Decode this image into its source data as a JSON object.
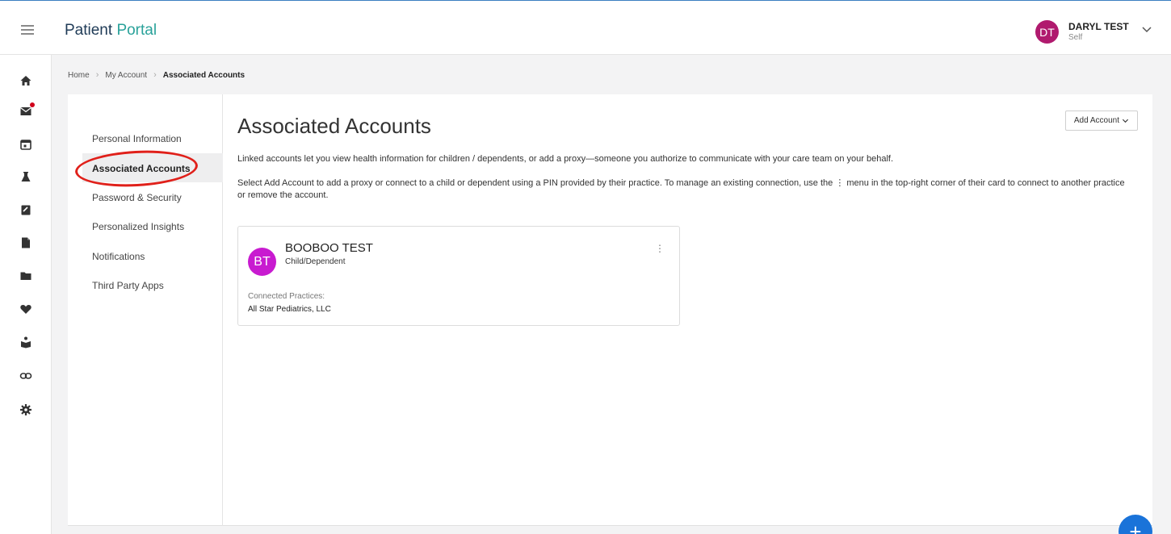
{
  "header": {
    "brand_main": "Patient",
    "brand_accent": "Portal",
    "user": {
      "initials": "DT",
      "name": "DARYL TEST",
      "role": "Self"
    }
  },
  "rail": {
    "icons": [
      "home-icon",
      "mail-icon",
      "calendar-icon",
      "lab-flask-icon",
      "clipboard-icon",
      "document-icon",
      "folder-icon",
      "heart-icon",
      "education-icon",
      "link-icon",
      "gear-icon"
    ]
  },
  "breadcrumb": {
    "home": "Home",
    "account": "My Account",
    "current": "Associated Accounts"
  },
  "side_menu": {
    "items": [
      {
        "label": "Personal Information"
      },
      {
        "label": "Associated Accounts"
      },
      {
        "label": "Password & Security"
      },
      {
        "label": "Personalized Insights"
      },
      {
        "label": "Notifications"
      },
      {
        "label": "Third Party Apps"
      }
    ]
  },
  "main": {
    "title": "Associated Accounts",
    "add_account_label": "Add Account",
    "description_1": "Linked accounts let you view health information for children / dependents, or add a proxy—someone you authorize to communicate with your care team on your behalf.",
    "description_2": "Select Add Account to add a proxy or connect to a child or dependent using a PIN provided by their practice. To manage an existing connection, use the ⋮ menu in the top-right corner of their card to connect to another practice or remove the account.",
    "account": {
      "initials": "BT",
      "name": "BOOBOO TEST",
      "type": "Child/Dependent",
      "connected_label": "Connected Practices:",
      "practice": "All Star Pediatrics, LLC"
    }
  },
  "fab_label": "+",
  "colors": {
    "brand_accent": "#2aa29a",
    "user_avatar": "#b01a6e",
    "child_avatar": "#c81bd0",
    "fab": "#1a73d9",
    "annotation": "#e0201a"
  }
}
